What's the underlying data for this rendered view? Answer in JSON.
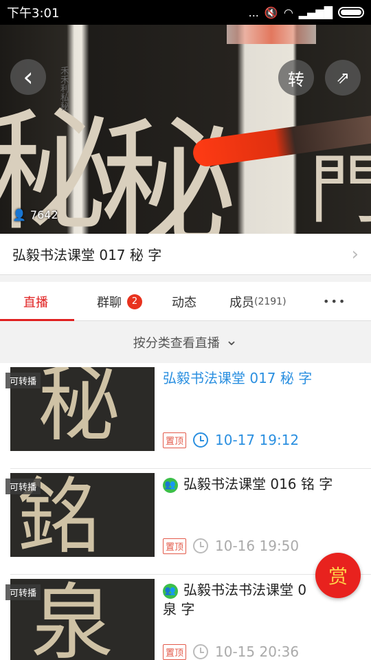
{
  "status_bar": {
    "time": "下午3:01",
    "dots": "...",
    "signal": "▂▄▆█"
  },
  "hero": {
    "back_icon": "‹",
    "repost_label": "转",
    "share_icon": "⇗",
    "viewer_count": "7642",
    "chars": [
      "秘",
      "秘",
      "門"
    ],
    "small_chars": "禾禾利私秘"
  },
  "title_row": {
    "title": "弘毅书法课堂 017 秘 字",
    "chevron": "›"
  },
  "tabs": {
    "live": "直播",
    "group_chat": "群聊",
    "group_chat_badge": "2",
    "feed": "动态",
    "members": "成员",
    "members_count": "(2191)",
    "more": "•••"
  },
  "filter": {
    "label": "按分类查看直播",
    "arrow": "⌄"
  },
  "items": [
    {
      "tag": "可转播",
      "title": "弘毅书法课堂 017 秘 字",
      "pin": "置顶",
      "time": "10-17 19:12",
      "char": "秘"
    },
    {
      "tag": "可转播",
      "title": "弘毅书法课堂 016 铭 字",
      "pin": "置顶",
      "time": "10-16 19:50",
      "char": "銘"
    },
    {
      "tag": "可转播",
      "title": "弘毅书法书法课堂 0",
      "title2": "泉 字",
      "pin": "置顶",
      "time": "10-15 20:36",
      "char": "泉"
    }
  ],
  "reward_label": "赏"
}
